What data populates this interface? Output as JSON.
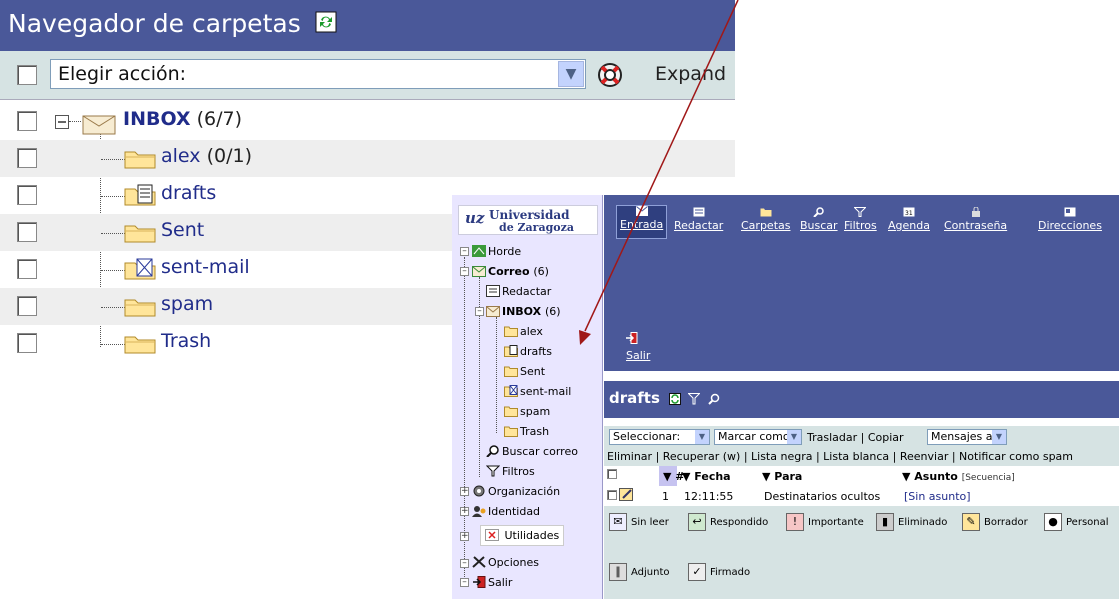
{
  "navigator": {
    "title": "Navegador de carpetas",
    "action_select": "Elegir acción:",
    "expand_label": "Expand",
    "folders": [
      {
        "name": "INBOX",
        "count": "(6/7)"
      },
      {
        "name": "alex",
        "count": "(0/1)"
      },
      {
        "name": "drafts",
        "count": ""
      },
      {
        "name": "Sent",
        "count": ""
      },
      {
        "name": "sent-mail",
        "count": ""
      },
      {
        "name": "spam",
        "count": ""
      },
      {
        "name": "Trash",
        "count": ""
      }
    ]
  },
  "sidebar": {
    "logo_line1": "Universidad",
    "logo_line2": "de Zaragoza",
    "items": [
      {
        "label": "Horde"
      },
      {
        "label": "Correo",
        "count": "(6)"
      },
      {
        "label": "Redactar"
      },
      {
        "label": "INBOX",
        "count": "(6)"
      },
      {
        "label": "alex"
      },
      {
        "label": "drafts"
      },
      {
        "label": "Sent"
      },
      {
        "label": "sent-mail"
      },
      {
        "label": "spam"
      },
      {
        "label": "Trash"
      },
      {
        "label": "Buscar correo"
      },
      {
        "label": "Filtros"
      },
      {
        "label": "Organización"
      },
      {
        "label": "Identidad"
      },
      {
        "label": "Utilidades"
      },
      {
        "label": "Opciones"
      },
      {
        "label": "Salir"
      }
    ]
  },
  "topbar": {
    "items": [
      "Entrada",
      "Redactar",
      "Carpetas",
      "Buscar",
      "Filtros",
      "Agenda",
      "Contraseña",
      "Direcciones"
    ],
    "salir": "Salir"
  },
  "mailbox": {
    "folder_title": "drafts",
    "select_label": "Seleccionar:",
    "mark_label": "Marcar como:",
    "move_text": "Trasladar | Copiar",
    "messages_to": "Mensajes a",
    "actions_line": "Eliminar | Recuperar (w) | Lista negra | Lista blanca | Reenviar | Notificar como spam",
    "columns": {
      "num": "#",
      "date": "Fecha",
      "to": "Para",
      "subject": "Asunto",
      "sequence": "[Secuencia]"
    },
    "rows": [
      {
        "num": "1",
        "date": "12:11:55",
        "to": "Destinatarios ocultos",
        "subject": "[Sin asunto]"
      }
    ],
    "legend": [
      "Sin leer",
      "Respondido",
      "Importante",
      "Eliminado",
      "Borrador",
      "Personal",
      "Adjunto",
      "Firmado"
    ]
  },
  "colors": {
    "header_bg": "#4a5899",
    "toolbar_bg": "#d6e3e3",
    "sidebar_bg": "#e9e6ff",
    "link": "#202c8a",
    "arrow": "#a01818"
  }
}
